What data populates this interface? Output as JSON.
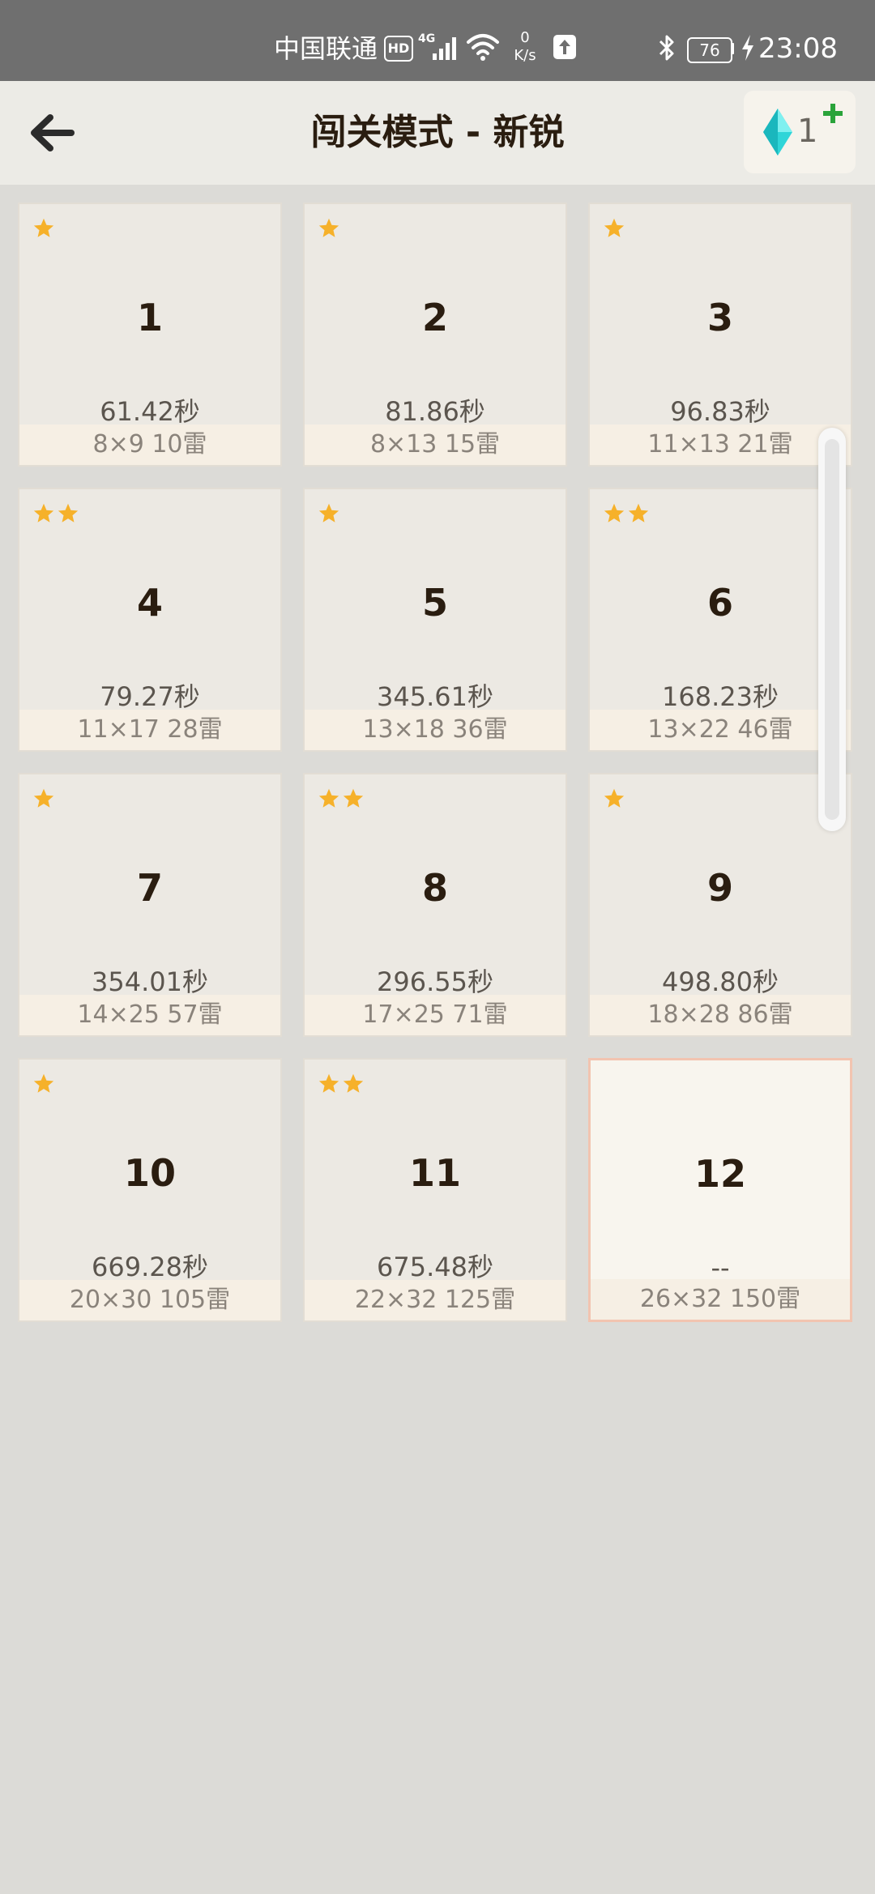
{
  "status_bar": {
    "carrier": "中国联通",
    "hd": "HD",
    "network": "4G",
    "speed_value": "0",
    "speed_unit": "K/s",
    "battery": "76",
    "time": "23:08"
  },
  "header": {
    "title": "闯关模式 - 新锐",
    "gem_count": "1"
  },
  "colors": {
    "star": "#f6b12a",
    "gem": "#2fd5d8",
    "plus": "#2aa33a"
  },
  "levels": [
    {
      "num": "1",
      "stars": 1,
      "time": "61.42秒",
      "info": "8×9  10雷"
    },
    {
      "num": "2",
      "stars": 1,
      "time": "81.86秒",
      "info": "8×13  15雷"
    },
    {
      "num": "3",
      "stars": 1,
      "time": "96.83秒",
      "info": "11×13  21雷"
    },
    {
      "num": "4",
      "stars": 2,
      "time": "79.27秒",
      "info": "11×17  28雷"
    },
    {
      "num": "5",
      "stars": 1,
      "time": "345.61秒",
      "info": "13×18  36雷"
    },
    {
      "num": "6",
      "stars": 2,
      "time": "168.23秒",
      "info": "13×22  46雷"
    },
    {
      "num": "7",
      "stars": 1,
      "time": "354.01秒",
      "info": "14×25  57雷"
    },
    {
      "num": "8",
      "stars": 2,
      "time": "296.55秒",
      "info": "17×25  71雷"
    },
    {
      "num": "9",
      "stars": 1,
      "time": "498.80秒",
      "info": "18×28  86雷"
    },
    {
      "num": "10",
      "stars": 1,
      "time": "669.28秒",
      "info": "20×30  105雷"
    },
    {
      "num": "11",
      "stars": 2,
      "time": "675.48秒",
      "info": "22×32  125雷"
    },
    {
      "num": "12",
      "stars": 0,
      "time": "--",
      "info": "26×32  150雷"
    }
  ]
}
